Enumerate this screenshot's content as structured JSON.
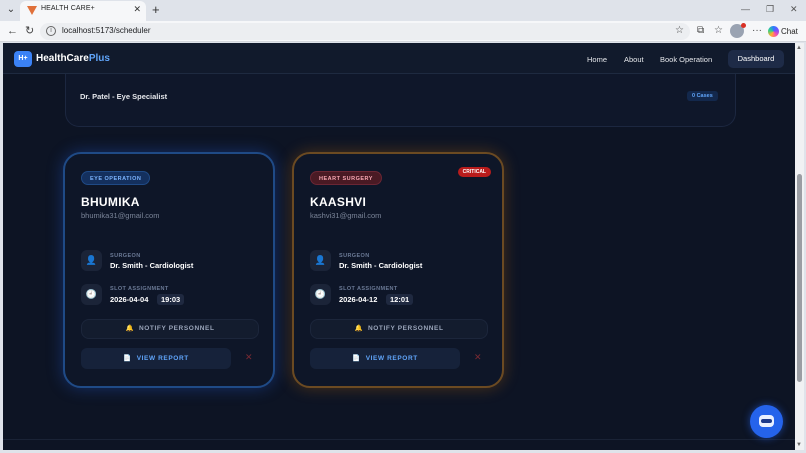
{
  "browser": {
    "tab_title": "HEALTH CARE+",
    "tab_close": "✕",
    "new_tab": "+",
    "url": "localhost:5173/scheduler",
    "chat_label": "Chat",
    "controls": {
      "minimize": "—",
      "restore": "❐",
      "close": "✕"
    }
  },
  "navbar": {
    "logo_badge": "H+",
    "logo_main": "HealthCare",
    "logo_accent": "Plus",
    "links": {
      "home": "Home",
      "about": "About",
      "book": "Book Operation",
      "dashboard": "Dashboard"
    }
  },
  "specialist": {
    "name": "Dr. Patel - Eye Specialist",
    "cases": "0 Cases"
  },
  "labels": {
    "surgeon": "SURGEON",
    "slot": "SLOT ASSIGNMENT",
    "notify": "NOTIFY PERSONNEL",
    "report": "VIEW REPORT"
  },
  "operations": [
    {
      "tag": "EYE OPERATION",
      "name": "BHUMIKA",
      "email": "bhumika31@gmail.com",
      "surgeon": "Dr. Smith - Cardiologist",
      "date": "2026-04-04",
      "time": "19:03"
    },
    {
      "tag": "HEART SURGERY",
      "critical": "CRITICAL",
      "name": "KAASHVI",
      "email": "kashvi31@gmail.com",
      "surgeon": "Dr. Smith - Cardiologist",
      "date": "2026-04-12",
      "time": "12:01"
    }
  ],
  "icons": {
    "surgeon": "person-icon",
    "slot": "clock-icon",
    "notify": "bell-icon",
    "report": "document-icon",
    "delete": "close-icon",
    "assistant": "robot-icon"
  },
  "colors": {
    "page_bg": "#0d1424",
    "accent_blue": "#3b82f6",
    "critical_red": "#b91c1c",
    "blue_card_border": "#1f4a86",
    "orange_card_border": "#6b4a22"
  }
}
